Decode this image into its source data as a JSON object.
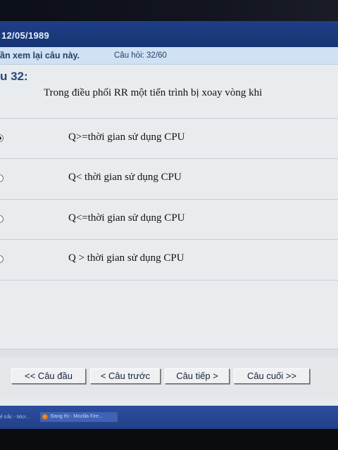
{
  "header": {
    "date": "12/05/1989"
  },
  "info": {
    "review_flag": "ần xem lại câu này.",
    "progress": "Câu hỏi: 32/60"
  },
  "question": {
    "number": "u 32:",
    "text": "Trong điều phối RR một tiến trình bị xoay vòng khi",
    "options": [
      {
        "label": "Q>=thời gian sử dụng CPU",
        "selected": true
      },
      {
        "label": "Q< thời gian sử dụng CPU",
        "selected": false
      },
      {
        "label": "Q<=thời gian sử dụng CPU",
        "selected": false
      },
      {
        "label": "Q > thời gian sử dụng CPU",
        "selected": false
      }
    ]
  },
  "nav": {
    "first": "<< Câu đầu",
    "prev": "< Câu trước",
    "next": "Câu tiếp >",
    "last": "Câu cuối >>"
  },
  "taskbar": {
    "item1": "ế trắc - Micr...",
    "item2": "Đang thi - Mozilla Fire..."
  }
}
